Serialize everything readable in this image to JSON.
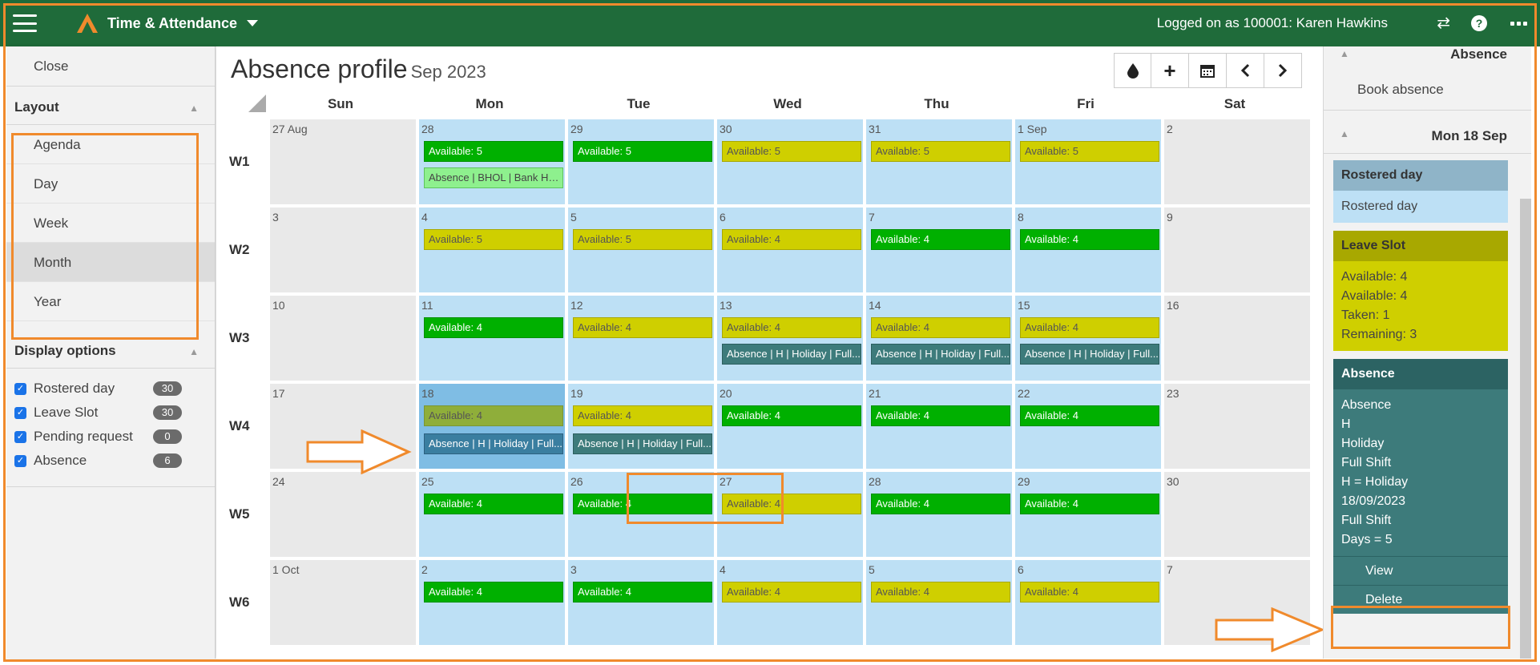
{
  "header": {
    "app_title": "Time & Attendance",
    "logged_on": "Logged on as 100001: Karen Hawkins",
    "help": "?"
  },
  "left": {
    "close": "Close",
    "layout_title": "Layout",
    "layout_items": [
      "Agenda",
      "Day",
      "Week",
      "Month",
      "Year"
    ],
    "active_layout": "Month",
    "display_title": "Display options",
    "options": [
      {
        "label": "Rostered day",
        "count": "30",
        "checked": true
      },
      {
        "label": "Leave Slot",
        "count": "30",
        "checked": true
      },
      {
        "label": "Pending request",
        "count": "0",
        "checked": true
      },
      {
        "label": "Absence",
        "count": "6",
        "checked": true
      }
    ]
  },
  "main": {
    "title": "Absence profile",
    "subtitle": "Sep 2023",
    "days": [
      "Sun",
      "Mon",
      "Tue",
      "Wed",
      "Thu",
      "Fri",
      "Sat"
    ],
    "weeks": [
      {
        "label": "W1",
        "dates": [
          "27 Aug",
          "28",
          "29",
          "30",
          "31",
          "1 Sep",
          "2"
        ]
      },
      {
        "label": "W2",
        "dates": [
          "3",
          "4",
          "5",
          "6",
          "7",
          "8",
          "9"
        ]
      },
      {
        "label": "W3",
        "dates": [
          "10",
          "11",
          "12",
          "13",
          "14",
          "15",
          "16"
        ]
      },
      {
        "label": "W4",
        "dates": [
          "17",
          "18",
          "19",
          "20",
          "21",
          "22",
          "23"
        ]
      },
      {
        "label": "W5",
        "dates": [
          "24",
          "25",
          "26",
          "27",
          "28",
          "29",
          "30"
        ]
      },
      {
        "label": "W6",
        "dates": [
          "1 Oct",
          "2",
          "3",
          "4",
          "5",
          "6",
          "7"
        ]
      }
    ],
    "events": {
      "w1": [
        "Available: 5",
        "Available: 5",
        "Available: 5",
        "Available: 5",
        "Available: 5",
        "Absence | BHOL | Bank Ho..."
      ],
      "w2": [
        "Available: 5",
        "Available: 5",
        "Available: 4",
        "Available: 4",
        "Available: 4"
      ],
      "w3": [
        "Available: 4",
        "Available: 4",
        "Available: 4",
        "Available: 4",
        "Available: 4",
        "Absence | H | Holiday | Full..."
      ],
      "w4": [
        "Available: 4",
        "Available: 4",
        "Available: 4",
        "Available: 4",
        "Available: 4",
        "Absence | H | Holiday | Full..."
      ],
      "w5": [
        "Available: 4",
        "Available: 4",
        "Available: 4",
        "Available: 4",
        "Available: 4"
      ],
      "w6": [
        "Available: 4",
        "Available: 4",
        "Available: 4",
        "Available: 4",
        "Available: 4"
      ]
    }
  },
  "right": {
    "section_title": "Absence",
    "book": "Book absence",
    "date": "Mon 18 Sep",
    "roster_head": "Rostered day",
    "roster_body": "Rostered day",
    "leave_head": "Leave Slot",
    "leave_lines": [
      "Available: 4",
      "Available: 4",
      "Taken: 1",
      "Remaining: 3"
    ],
    "absence_head": "Absence",
    "absence_lines": [
      "Absence",
      "H",
      "Holiday",
      "Full Shift",
      "H = Holiday",
      "18/09/2023",
      "Full Shift",
      "Days = 5"
    ],
    "view": "View",
    "delete": "Delete"
  },
  "colors": {
    "header_green": "#1f6b3a",
    "available_green": "#00b000",
    "available_yellow": "#cfcf00",
    "absence_teal": "#3d7b7b",
    "annotation_orange": "#f08a2c"
  }
}
